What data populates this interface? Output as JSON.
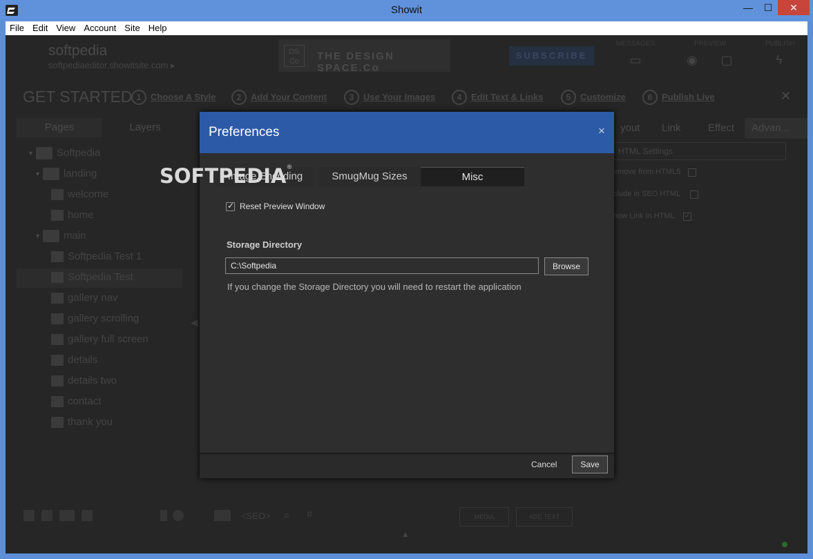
{
  "window": {
    "title": "Showit",
    "minimize": "—",
    "maximize": "☐",
    "close": "✕"
  },
  "menu": [
    "File",
    "Edit",
    "View",
    "Account",
    "Site",
    "Help"
  ],
  "header": {
    "site_name": "softpedia",
    "site_url": "softpediaeditor.showitsite.com ▸",
    "banner_logo": "DS\nCo",
    "banner_text": "THE DESIGN SPACE.Co",
    "subscribe": "SUBSCRIBE",
    "tools": [
      {
        "label": "MESSAGES",
        "icon": "inbox-icon"
      },
      {
        "label": "PREVIEW",
        "icon": "eye-icon"
      },
      {
        "label": "PUBLISH",
        "icon": "lightning-icon"
      }
    ]
  },
  "get_started": {
    "title": "GET STARTED",
    "steps": [
      {
        "num": "1",
        "label": "Choose A Style"
      },
      {
        "num": "2",
        "label": "Add Your Content"
      },
      {
        "num": "3",
        "label": "Use Your Images"
      },
      {
        "num": "4",
        "label": "Edit Text & Links"
      },
      {
        "num": "5",
        "label": "Customize"
      },
      {
        "num": "6",
        "label": "Publish Live"
      }
    ],
    "close": "✕"
  },
  "left_panel": {
    "tabs": [
      "Pages",
      "Layers"
    ],
    "tree": [
      {
        "label": "Softpedia",
        "type": "folder",
        "level": 0
      },
      {
        "label": "landing",
        "type": "folder",
        "level": 1
      },
      {
        "label": "welcome",
        "type": "home",
        "level": 2
      },
      {
        "label": "home",
        "type": "home",
        "level": 2
      },
      {
        "label": "main",
        "type": "folder",
        "level": 1
      },
      {
        "label": "Softpedia Test 1",
        "type": "page",
        "level": 2
      },
      {
        "label": "Softpedia Test",
        "type": "page",
        "level": 2
      },
      {
        "label": "gallery nav",
        "type": "page",
        "level": 2
      },
      {
        "label": "gallery scrolling",
        "type": "page",
        "level": 2
      },
      {
        "label": "gallery full screen",
        "type": "page",
        "level": 2
      },
      {
        "label": "details",
        "type": "page",
        "level": 2
      },
      {
        "label": "details two",
        "type": "page",
        "level": 2
      },
      {
        "label": "contact",
        "type": "page",
        "level": 2
      },
      {
        "label": "thank you",
        "type": "page",
        "level": 2
      }
    ]
  },
  "right_panel": {
    "tabs": [
      "yout",
      "Link",
      "Effect",
      "Advan..."
    ],
    "html_settings": "HTML Settings",
    "checks": [
      {
        "label": "emove from HTML5",
        "checked": false
      },
      {
        "label": "clude in SEO HTML",
        "checked": false
      },
      {
        "label": "how Link In HTML",
        "checked": true
      }
    ]
  },
  "bottom_bar": {
    "seo_label": "<SEO>",
    "media_button": "MEDIA",
    "add_text_button": "ADD TEXT"
  },
  "watermark": "SOFTPEDIA",
  "watermark_mark": "®",
  "dialog": {
    "title": "Preferences",
    "close": "×",
    "tabs": [
      {
        "label": "Image Encoding",
        "active": false
      },
      {
        "label": "SmugMug Sizes",
        "active": false
      },
      {
        "label": "Misc",
        "active": true
      }
    ],
    "reset_preview": {
      "label": "Reset Preview Window",
      "checked": true,
      "mark": "✓"
    },
    "storage": {
      "label": "Storage Directory",
      "value": "C:\\Softpedia",
      "browse": "Browse",
      "hint": "If you change the Storage Directory you will need to restart the application"
    },
    "footer": {
      "cancel": "Cancel",
      "save": "Save"
    }
  },
  "colors": {
    "accent": "#2d5aa6",
    "titlebar": "#5f92db",
    "close_red": "#c7453b",
    "dialog_bg": "#2e2e2e"
  }
}
